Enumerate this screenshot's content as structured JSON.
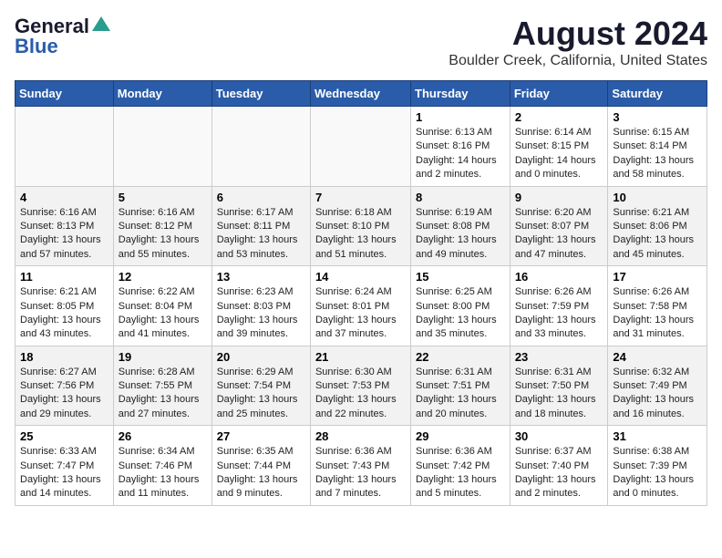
{
  "logo": {
    "line1": "General",
    "line2": "Blue"
  },
  "title": "August 2024",
  "subtitle": "Boulder Creek, California, United States",
  "days_of_week": [
    "Sunday",
    "Monday",
    "Tuesday",
    "Wednesday",
    "Thursday",
    "Friday",
    "Saturday"
  ],
  "weeks": [
    [
      {
        "num": "",
        "info": ""
      },
      {
        "num": "",
        "info": ""
      },
      {
        "num": "",
        "info": ""
      },
      {
        "num": "",
        "info": ""
      },
      {
        "num": "1",
        "info": "Sunrise: 6:13 AM\nSunset: 8:16 PM\nDaylight: 14 hours\nand 2 minutes."
      },
      {
        "num": "2",
        "info": "Sunrise: 6:14 AM\nSunset: 8:15 PM\nDaylight: 14 hours\nand 0 minutes."
      },
      {
        "num": "3",
        "info": "Sunrise: 6:15 AM\nSunset: 8:14 PM\nDaylight: 13 hours\nand 58 minutes."
      }
    ],
    [
      {
        "num": "4",
        "info": "Sunrise: 6:16 AM\nSunset: 8:13 PM\nDaylight: 13 hours\nand 57 minutes."
      },
      {
        "num": "5",
        "info": "Sunrise: 6:16 AM\nSunset: 8:12 PM\nDaylight: 13 hours\nand 55 minutes."
      },
      {
        "num": "6",
        "info": "Sunrise: 6:17 AM\nSunset: 8:11 PM\nDaylight: 13 hours\nand 53 minutes."
      },
      {
        "num": "7",
        "info": "Sunrise: 6:18 AM\nSunset: 8:10 PM\nDaylight: 13 hours\nand 51 minutes."
      },
      {
        "num": "8",
        "info": "Sunrise: 6:19 AM\nSunset: 8:08 PM\nDaylight: 13 hours\nand 49 minutes."
      },
      {
        "num": "9",
        "info": "Sunrise: 6:20 AM\nSunset: 8:07 PM\nDaylight: 13 hours\nand 47 minutes."
      },
      {
        "num": "10",
        "info": "Sunrise: 6:21 AM\nSunset: 8:06 PM\nDaylight: 13 hours\nand 45 minutes."
      }
    ],
    [
      {
        "num": "11",
        "info": "Sunrise: 6:21 AM\nSunset: 8:05 PM\nDaylight: 13 hours\nand 43 minutes."
      },
      {
        "num": "12",
        "info": "Sunrise: 6:22 AM\nSunset: 8:04 PM\nDaylight: 13 hours\nand 41 minutes."
      },
      {
        "num": "13",
        "info": "Sunrise: 6:23 AM\nSunset: 8:03 PM\nDaylight: 13 hours\nand 39 minutes."
      },
      {
        "num": "14",
        "info": "Sunrise: 6:24 AM\nSunset: 8:01 PM\nDaylight: 13 hours\nand 37 minutes."
      },
      {
        "num": "15",
        "info": "Sunrise: 6:25 AM\nSunset: 8:00 PM\nDaylight: 13 hours\nand 35 minutes."
      },
      {
        "num": "16",
        "info": "Sunrise: 6:26 AM\nSunset: 7:59 PM\nDaylight: 13 hours\nand 33 minutes."
      },
      {
        "num": "17",
        "info": "Sunrise: 6:26 AM\nSunset: 7:58 PM\nDaylight: 13 hours\nand 31 minutes."
      }
    ],
    [
      {
        "num": "18",
        "info": "Sunrise: 6:27 AM\nSunset: 7:56 PM\nDaylight: 13 hours\nand 29 minutes."
      },
      {
        "num": "19",
        "info": "Sunrise: 6:28 AM\nSunset: 7:55 PM\nDaylight: 13 hours\nand 27 minutes."
      },
      {
        "num": "20",
        "info": "Sunrise: 6:29 AM\nSunset: 7:54 PM\nDaylight: 13 hours\nand 25 minutes."
      },
      {
        "num": "21",
        "info": "Sunrise: 6:30 AM\nSunset: 7:53 PM\nDaylight: 13 hours\nand 22 minutes."
      },
      {
        "num": "22",
        "info": "Sunrise: 6:31 AM\nSunset: 7:51 PM\nDaylight: 13 hours\nand 20 minutes."
      },
      {
        "num": "23",
        "info": "Sunrise: 6:31 AM\nSunset: 7:50 PM\nDaylight: 13 hours\nand 18 minutes."
      },
      {
        "num": "24",
        "info": "Sunrise: 6:32 AM\nSunset: 7:49 PM\nDaylight: 13 hours\nand 16 minutes."
      }
    ],
    [
      {
        "num": "25",
        "info": "Sunrise: 6:33 AM\nSunset: 7:47 PM\nDaylight: 13 hours\nand 14 minutes."
      },
      {
        "num": "26",
        "info": "Sunrise: 6:34 AM\nSunset: 7:46 PM\nDaylight: 13 hours\nand 11 minutes."
      },
      {
        "num": "27",
        "info": "Sunrise: 6:35 AM\nSunset: 7:44 PM\nDaylight: 13 hours\nand 9 minutes."
      },
      {
        "num": "28",
        "info": "Sunrise: 6:36 AM\nSunset: 7:43 PM\nDaylight: 13 hours\nand 7 minutes."
      },
      {
        "num": "29",
        "info": "Sunrise: 6:36 AM\nSunset: 7:42 PM\nDaylight: 13 hours\nand 5 minutes."
      },
      {
        "num": "30",
        "info": "Sunrise: 6:37 AM\nSunset: 7:40 PM\nDaylight: 13 hours\nand 2 minutes."
      },
      {
        "num": "31",
        "info": "Sunrise: 6:38 AM\nSunset: 7:39 PM\nDaylight: 13 hours\nand 0 minutes."
      }
    ]
  ]
}
